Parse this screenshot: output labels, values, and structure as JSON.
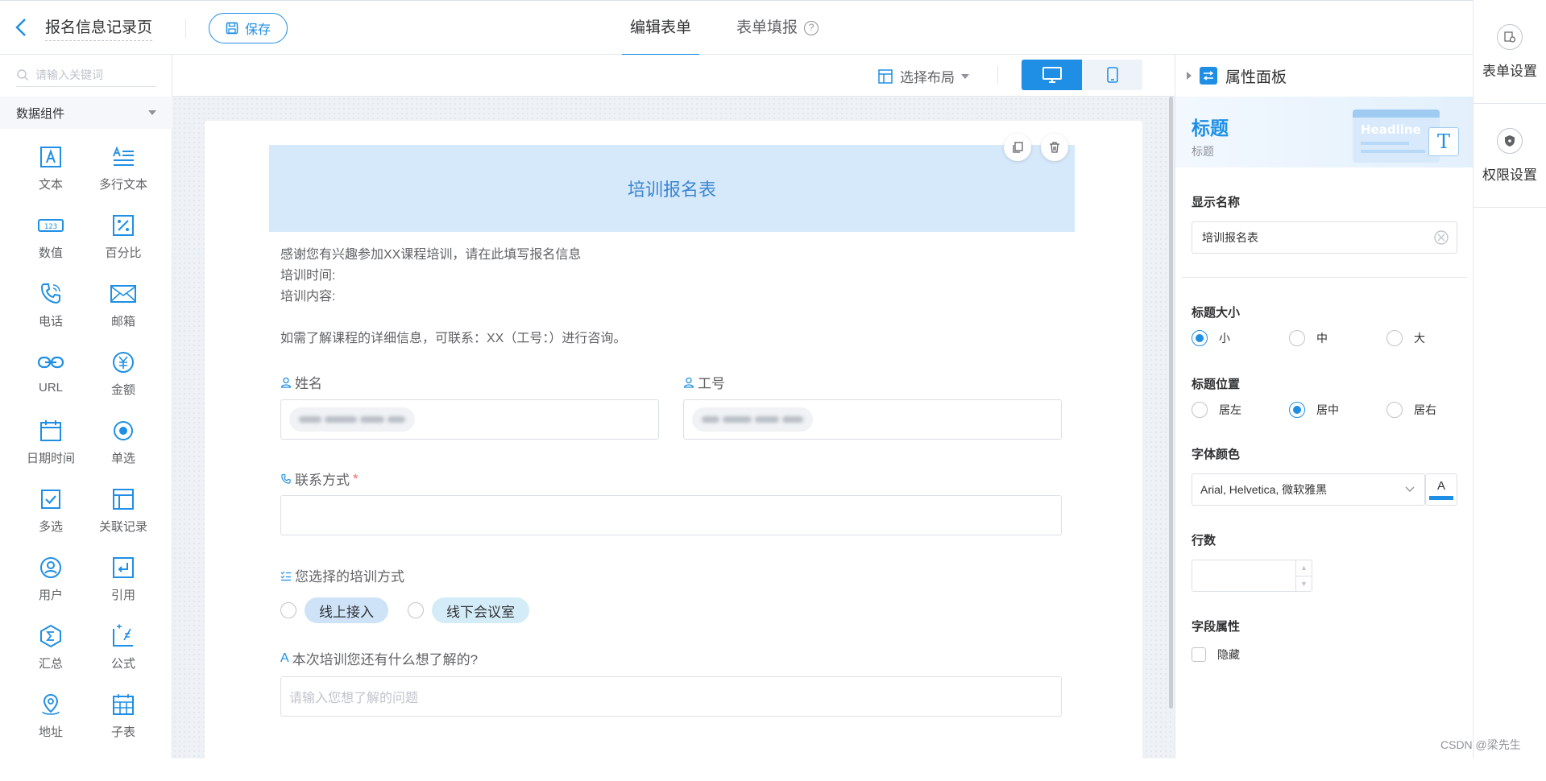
{
  "header": {
    "page_title": "报名信息记录页",
    "save_label": "保存",
    "tabs": [
      {
        "label": "编辑表单"
      },
      {
        "label": "表单填报"
      }
    ],
    "help_glyph": "?"
  },
  "right_rail": {
    "items": [
      {
        "label": "表单设置",
        "icon": "form-settings-icon"
      },
      {
        "label": "权限设置",
        "icon": "shield-icon"
      }
    ]
  },
  "left_panel": {
    "search_placeholder": "请输入关键词",
    "group_title": "数据组件",
    "components": [
      {
        "label": "文本",
        "icon": "text-icon"
      },
      {
        "label": "多行文本",
        "icon": "multiline-text-icon"
      },
      {
        "label": "数值",
        "icon": "number-icon"
      },
      {
        "label": "百分比",
        "icon": "percent-icon"
      },
      {
        "label": "电话",
        "icon": "phone-icon"
      },
      {
        "label": "邮箱",
        "icon": "mail-icon"
      },
      {
        "label": "URL",
        "icon": "link-icon"
      },
      {
        "label": "金额",
        "icon": "currency-icon"
      },
      {
        "label": "日期时间",
        "icon": "calendar-icon"
      },
      {
        "label": "单选",
        "icon": "radio-icon"
      },
      {
        "label": "多选",
        "icon": "checkbox-icon"
      },
      {
        "label": "关联记录",
        "icon": "relation-icon"
      },
      {
        "label": "用户",
        "icon": "user-icon"
      },
      {
        "label": "引用",
        "icon": "reference-icon"
      },
      {
        "label": "汇总",
        "icon": "sum-icon"
      },
      {
        "label": "公式",
        "icon": "formula-icon"
      },
      {
        "label": "地址",
        "icon": "location-icon"
      },
      {
        "label": "子表",
        "icon": "subtable-icon"
      }
    ]
  },
  "toolbar": {
    "layout_label": "选择布局"
  },
  "form": {
    "title": "培训报名表",
    "description": [
      "感谢您有兴趣参加XX课程培训，请在此填写报名信息",
      "培训时间:",
      "培训内容:",
      "",
      "如需了解课程的详细信息，可联系：XX（工号：）进行咨询。"
    ],
    "fields": {
      "name_label": "姓名",
      "employee_id_label": "工号",
      "contact_label": "联系方式",
      "required_mark": "*",
      "mode_label": "您选择的培训方式",
      "mode_options": [
        "线上接入",
        "线下会议室"
      ],
      "question_label": "本次培训您还有什么想了解的?",
      "question_placeholder": "请输入您想了解的问题"
    }
  },
  "props_panel": {
    "header": "属性面板",
    "banner_title": "标题",
    "banner_sub": "标题",
    "banner_art_text": "Headline",
    "banner_art_glyph": "T",
    "display_name_label": "显示名称",
    "display_name_value": "培训报名表",
    "title_size_label": "标题大小",
    "title_size_options": [
      "小",
      "中",
      "大"
    ],
    "title_size_selected": "小",
    "title_pos_label": "标题位置",
    "title_pos_options": [
      "居左",
      "居中",
      "居右"
    ],
    "title_pos_selected": "居中",
    "font_color_label": "字体颜色",
    "font_family_value": "Arial, Helvetica, 微软雅黑",
    "font_color_glyph": "A",
    "font_color": "#1f8fe5",
    "rows_label": "行数",
    "field_attr_label": "字段属性",
    "hidden_label": "隐藏"
  },
  "watermark": "CSDN @梁先生 ",
  "colors": {
    "accent": "#1f8fe5",
    "title_band": "#d6e9fb",
    "pill_online": "#cfe3f8",
    "pill_offline": "#d4ecf8"
  }
}
